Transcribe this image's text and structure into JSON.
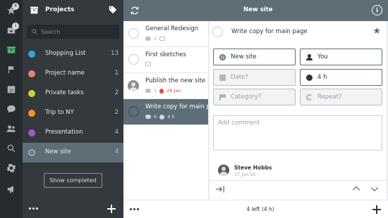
{
  "rail": {
    "badges": {
      "inbox": "8",
      "today": "1"
    },
    "calendar_day": "10"
  },
  "projects_panel": {
    "title": "Projects",
    "search_placeholder": "Search",
    "items": [
      {
        "name": "Shopping List",
        "count": "13",
        "color": "#2ca9e1"
      },
      {
        "name": "Project name",
        "count": "1",
        "color": "#f2806b"
      },
      {
        "name": "Private tasks",
        "count": "2",
        "color": "#c8d435"
      },
      {
        "name": "Trip to NY",
        "count": "2",
        "color": "#f3951d"
      },
      {
        "name": "Presentation",
        "count": "4",
        "color": "#a655d6"
      },
      {
        "name": "New site",
        "count": "4",
        "color": "#9fa7ac",
        "selected": true
      }
    ],
    "show_completed_label": "Show completed"
  },
  "header": {
    "title": "New site"
  },
  "tasks": [
    {
      "title": "General Redesign",
      "comments": "1",
      "due": "",
      "duration": ""
    },
    {
      "title": "First sketches",
      "comments": "",
      "due": "",
      "duration": ""
    },
    {
      "title": "Publish the new site",
      "comments": "1",
      "due": "28 Jan",
      "duration": ""
    },
    {
      "title": "Write copy for main page",
      "comments": "6",
      "due": "",
      "duration": "4 h",
      "selected": true
    }
  ],
  "detail": {
    "title": "Write copy for main page",
    "project": "New site",
    "assignee": "You",
    "date_placeholder": "Date?",
    "duration": "4 h",
    "category_placeholder": "Category?",
    "repeat_placeholder": "Repeat?",
    "comment_placeholder": "Add comment",
    "comment_author": "Steve Hobbs",
    "comment_date": "17 Jun'15"
  },
  "footer": {
    "status": "4 left (4 h)"
  },
  "colors": {
    "accent": "#5e6e77",
    "active_green": "#4cb86f",
    "due_red": "#e04b3b"
  }
}
